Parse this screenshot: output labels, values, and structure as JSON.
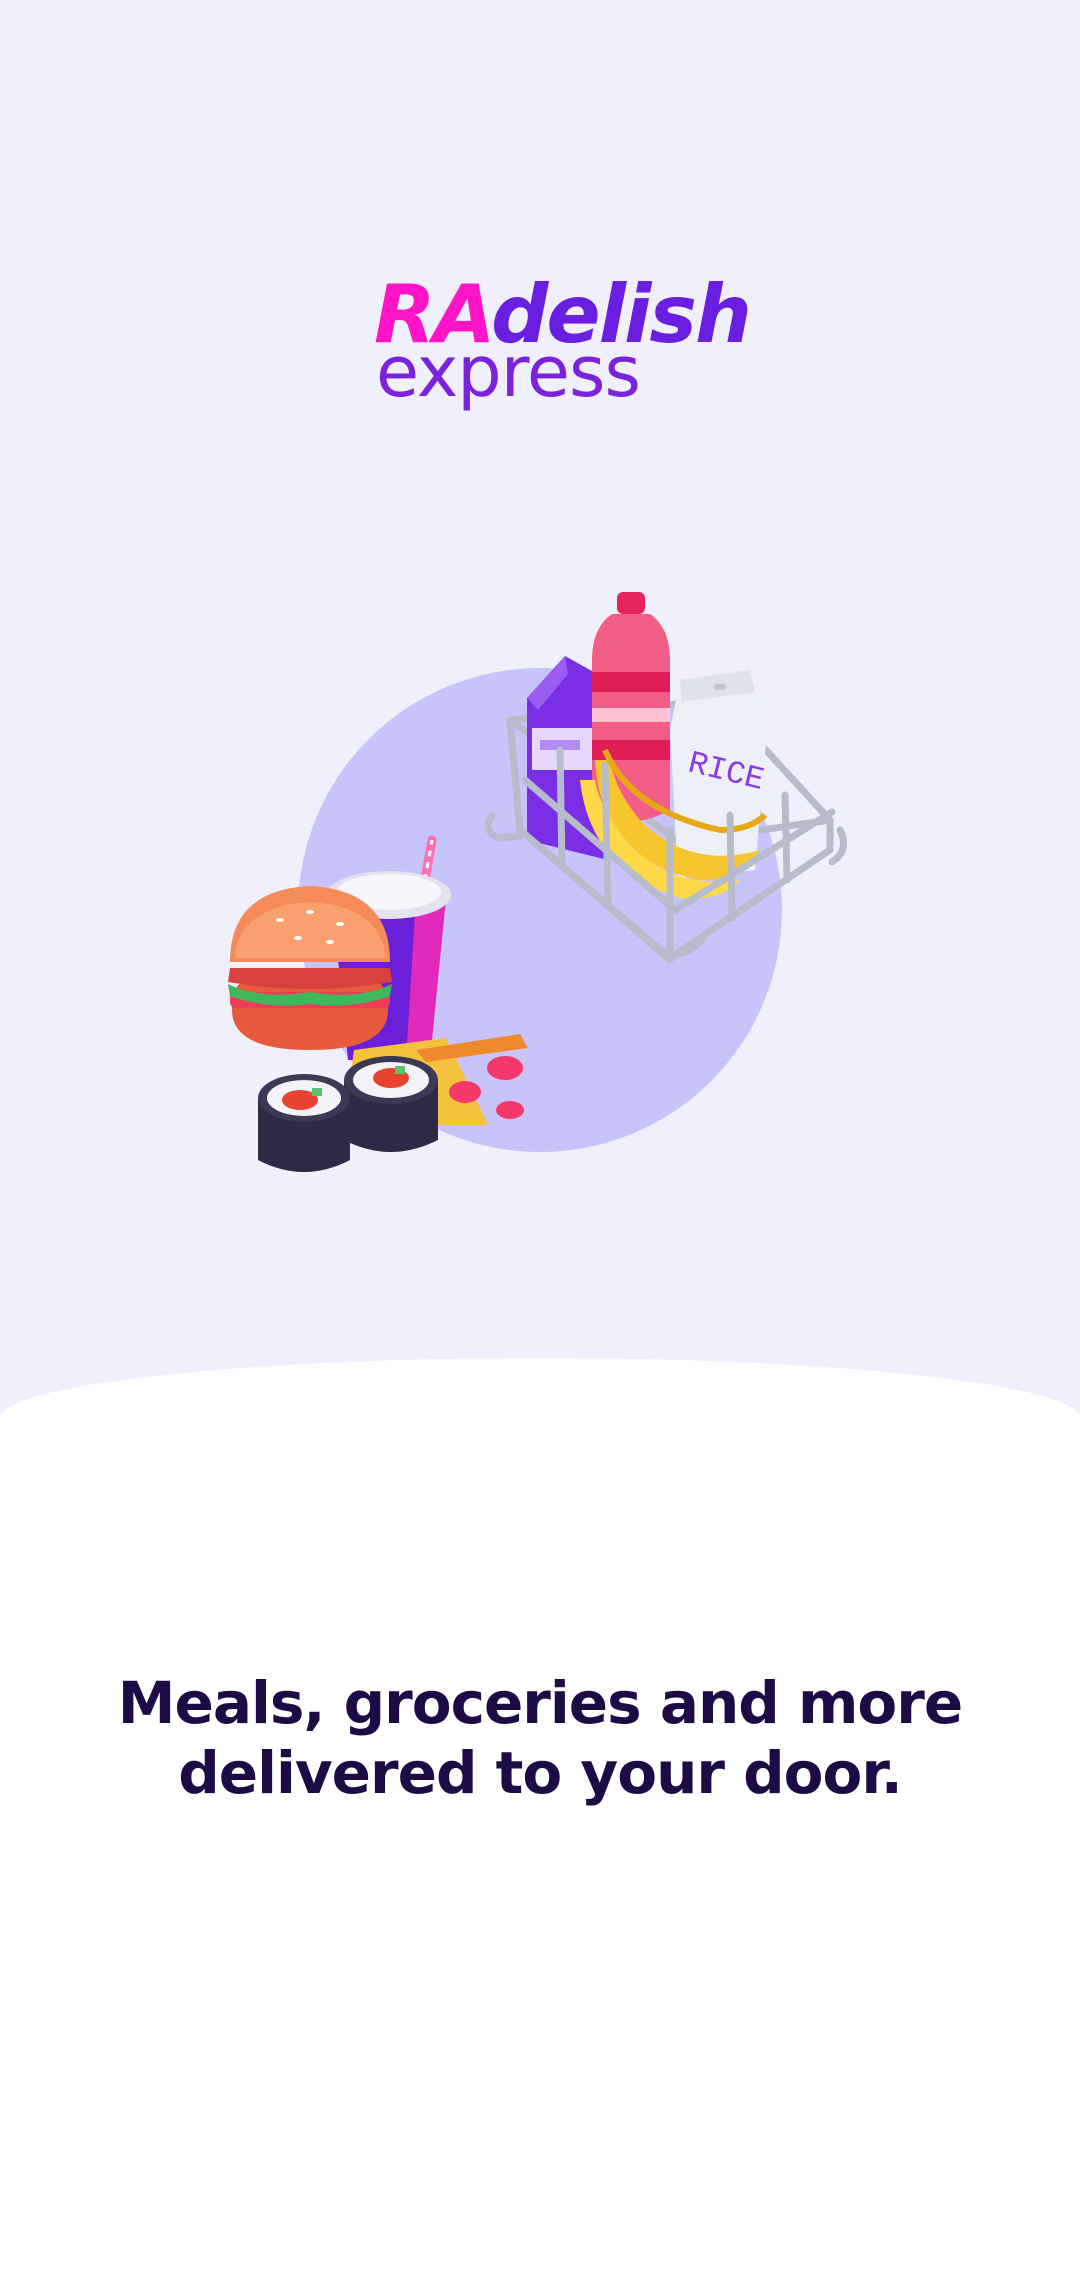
{
  "logo": {
    "brand_part1": "RA",
    "brand_part2": "delish",
    "brand_part3": "express"
  },
  "hero": {
    "illustration_items": [
      "basket-icon",
      "milk-carton-icon",
      "bottle-icon",
      "rice-bag-icon",
      "bananas-icon",
      "drink-cup-icon",
      "burger-icon",
      "pizza-slice-icon",
      "sushi-icon"
    ],
    "rice_label": "RICE"
  },
  "onboarding": {
    "headline_line1": "Meals, groceries and more",
    "headline_line2": "delivered to your door."
  },
  "colors": {
    "background": "#f0effc",
    "sheet": "#ffffff",
    "headline": "#1d0b45",
    "brand_pink": "#ff14c8",
    "brand_purple": "#6a1fe0",
    "circle": "#c9c3fb"
  }
}
